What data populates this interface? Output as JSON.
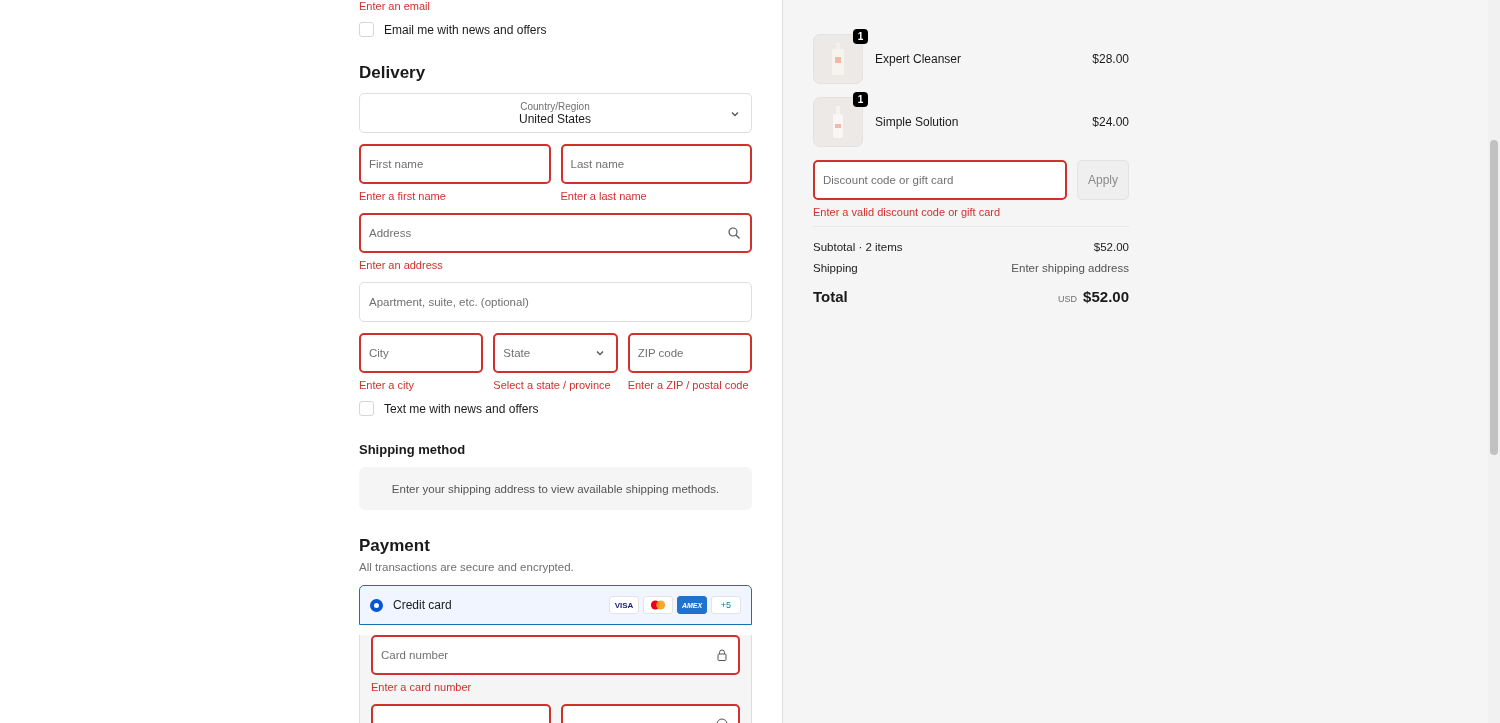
{
  "contact": {
    "error": "Enter an email",
    "opt_in": {
      "label": "Email me with news and offers",
      "checked": false
    }
  },
  "delivery": {
    "title": "Delivery",
    "country": {
      "label": "Country/Region",
      "value": "United States"
    },
    "rows": [
      [
        {
          "kind": "text",
          "placeholder": "First name",
          "invalid": true,
          "error": "Enter a first name"
        },
        {
          "kind": "text",
          "placeholder": "Last name",
          "invalid": true,
          "error": "Enter a last name"
        }
      ],
      [
        {
          "kind": "search",
          "placeholder": "Address",
          "invalid": true,
          "error": "Enter an address"
        }
      ],
      [
        {
          "kind": "text",
          "placeholder": "Apartment, suite, etc. (optional)",
          "invalid": false
        }
      ],
      [
        {
          "kind": "text",
          "placeholder": "City",
          "invalid": true,
          "error": "Enter a city"
        },
        {
          "kind": "select",
          "placeholder": "State",
          "invalid": true,
          "error": "Select a state / province"
        },
        {
          "kind": "text",
          "placeholder": "ZIP code",
          "invalid": true,
          "error": "Enter a ZIP / postal code"
        }
      ]
    ],
    "sms_opt_in": {
      "label": "Text me with news and offers",
      "checked": false
    }
  },
  "shipping_method": {
    "title": "Shipping method",
    "message": "Enter your shipping address to view available shipping methods."
  },
  "payment": {
    "title": "Payment",
    "subtitle": "All transactions are secure and encrypted.",
    "methods": [
      {
        "label": "Credit card",
        "selected": true,
        "brands": [
          {
            "kind": "visa",
            "label": "VISA"
          },
          {
            "kind": "mastercard"
          },
          {
            "kind": "amex",
            "label": "AMEX"
          },
          {
            "kind": "more",
            "label": "+5"
          }
        ]
      }
    ],
    "card_rows": [
      [
        {
          "kind": "lock",
          "placeholder": "Card number",
          "invalid": true,
          "error": "Enter a card number"
        }
      ],
      [
        {
          "kind": "text",
          "invalid": true
        },
        {
          "kind": "help",
          "invalid": true
        }
      ]
    ]
  },
  "summary": {
    "items": [
      {
        "name": "Expert Cleanser",
        "price": "$28.00",
        "quantity": "1"
      },
      {
        "name": "Simple Solution",
        "price": "$24.00",
        "quantity": "1"
      }
    ],
    "discount": {
      "placeholder": "Discount code or gift card",
      "invalid": true,
      "error": "Enter a valid discount code or gift card",
      "button": "Apply"
    },
    "subtotal": {
      "label": "Subtotal · 2 items",
      "value": "$52.00"
    },
    "shipping": {
      "label": "Shipping",
      "value": "Enter shipping address"
    },
    "total": {
      "label": "Total",
      "currency": "USD",
      "value": "$52.00"
    }
  }
}
